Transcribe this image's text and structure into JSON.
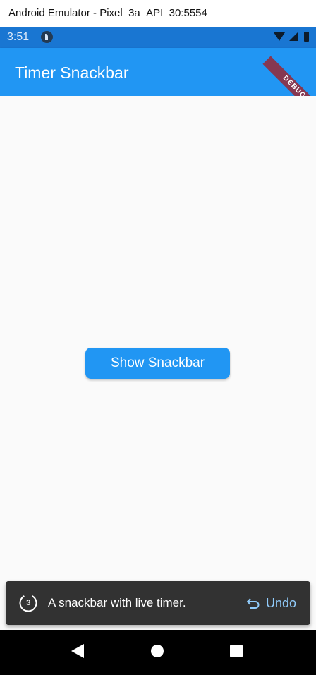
{
  "window": {
    "title": "Android Emulator - Pixel_3a_API_30:5554"
  },
  "status_bar": {
    "time": "3:51",
    "app_icon": "flutter-p-icon",
    "wifi_icon": "wifi-icon",
    "signal_icon": "signal-icon",
    "battery_icon": "battery-icon"
  },
  "app_bar": {
    "title": "Timer Snackbar",
    "debug_banner": "DEBUG"
  },
  "main": {
    "button_label": "Show Snackbar"
  },
  "snackbar": {
    "timer_value": "3",
    "message": "A snackbar with live timer.",
    "action_label": "Undo",
    "action_icon": "undo-icon"
  },
  "nav_bar": {
    "back_icon": "back-triangle-icon",
    "home_icon": "home-circle-icon",
    "recents_icon": "recents-square-icon"
  },
  "colors": {
    "primary": "#2196f3",
    "status_bar": "#1976d2",
    "snackbar_bg": "#323232",
    "action": "#90caf9",
    "background": "#fafafa"
  }
}
